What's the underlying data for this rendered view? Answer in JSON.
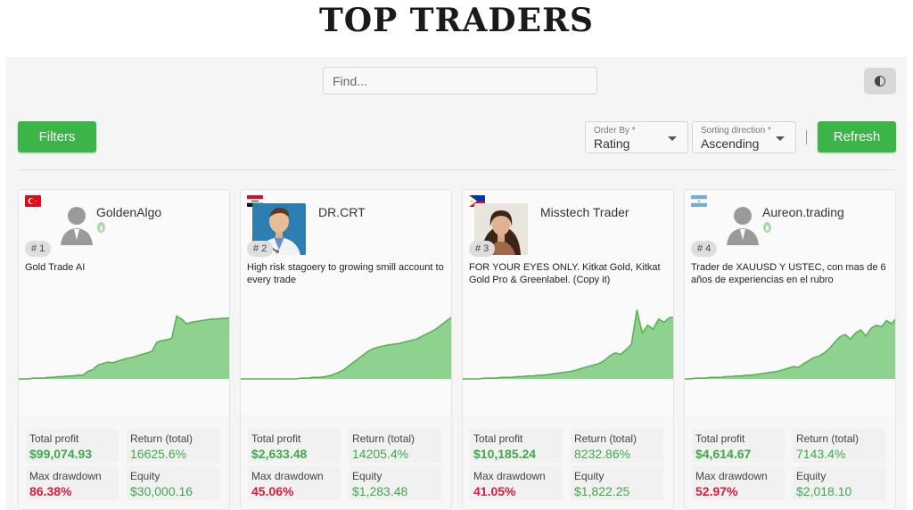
{
  "page_title": "TOP TRADERS",
  "search": {
    "placeholder": "Find..."
  },
  "toolbar": {
    "filters_label": "Filters",
    "refresh_label": "Refresh",
    "order_by": {
      "label": "Order By *",
      "value": "Rating"
    },
    "sorting_direction": {
      "label": "Sorting direction *",
      "value": "Ascending"
    }
  },
  "colors": {
    "accent": "#3cb448",
    "profit": "#3ea84a",
    "drawdown": "#d71c3f",
    "chart_fill": "#8fd18f",
    "chart_line": "#4fb24f"
  },
  "traders": [
    {
      "rank": "# 1",
      "name": "GoldenAlgo",
      "country_flag": "turkey",
      "avatar": "generic-user-icon",
      "description": "Gold Trade AI",
      "stats": {
        "total_profit_label": "Total profit",
        "total_profit": "$99,074.93",
        "return_label": "Return (total)",
        "return": "16625.6%",
        "max_drawdown_label": "Max drawdown",
        "max_drawdown": "86.38%",
        "equity_label": "Equity",
        "equity": "$30,000.16"
      },
      "equity_curve": [
        0.0,
        0.0,
        0.0,
        0.01,
        0.01,
        0.01,
        0.02,
        0.02,
        0.03,
        0.03,
        0.04,
        0.04,
        0.05,
        0.05,
        0.1,
        0.12,
        0.18,
        0.2,
        0.22,
        0.21,
        0.23,
        0.25,
        0.27,
        0.28,
        0.3,
        0.32,
        0.34,
        0.36,
        0.48,
        0.5,
        0.51,
        0.53,
        0.82,
        0.78,
        0.72,
        0.74,
        0.75,
        0.76,
        0.77,
        0.78,
        0.78,
        0.79,
        0.79,
        0.8
      ]
    },
    {
      "rank": "# 2",
      "name": "DR.CRT",
      "country_flag": "iraq",
      "avatar": "doctor-photo",
      "description": "High risk stagoery to growing smill account to every trade",
      "stats": {
        "total_profit_label": "Total profit",
        "total_profit": "$2,633.48",
        "return_label": "Return (total)",
        "return": "14205.4%",
        "max_drawdown_label": "Max drawdown",
        "max_drawdown": "45.06%",
        "equity_label": "Equity",
        "equity": "$1,283.48"
      },
      "equity_curve": [
        0.0,
        0.0,
        0.0,
        0.0,
        0.0,
        0.0,
        0.0,
        0.0,
        0.0,
        0.0,
        0.01,
        0.01,
        0.02,
        0.02,
        0.03,
        0.05,
        0.08,
        0.12,
        0.18,
        0.24,
        0.3,
        0.36,
        0.4,
        0.42,
        0.44,
        0.45,
        0.46,
        0.48,
        0.5,
        0.52,
        0.56,
        0.6,
        0.64,
        0.7,
        0.76,
        0.82
      ]
    },
    {
      "rank": "# 3",
      "name": "Misstech Trader",
      "country_flag": "philippines",
      "avatar": "woman-photo",
      "description": "FOR YOUR EYES ONLY. Kitkat Gold, Kitkat Gold Pro & Greenlabel. (Copy it)",
      "stats": {
        "total_profit_label": "Total profit",
        "total_profit": "$10,185.24",
        "return_label": "Return (total)",
        "return": "8232.86%",
        "max_drawdown_label": "Max drawdown",
        "max_drawdown": "41.05%",
        "equity_label": "Equity",
        "equity": "$1,822.25"
      },
      "equity_curve": [
        0.0,
        0.0,
        0.0,
        0.0,
        0.01,
        0.01,
        0.01,
        0.02,
        0.02,
        0.02,
        0.03,
        0.03,
        0.04,
        0.04,
        0.05,
        0.05,
        0.06,
        0.07,
        0.08,
        0.09,
        0.1,
        0.12,
        0.14,
        0.16,
        0.18,
        0.2,
        0.24,
        0.3,
        0.34,
        0.32,
        0.38,
        0.45,
        0.9,
        0.6,
        0.7,
        0.65,
        0.78,
        0.74,
        0.8,
        0.8
      ]
    },
    {
      "rank": "# 4",
      "name": "Aureon.trading",
      "country_flag": "argentina",
      "avatar": "generic-user-icon",
      "description": "Trader de XAUUSD Y USTEC, con mas de 6 años de experiencias en el rubro",
      "stats": {
        "total_profit_label": "Total profit",
        "total_profit": "$4,614.67",
        "return_label": "Return (total)",
        "return": "7143.4%",
        "max_drawdown_label": "Max drawdown",
        "max_drawdown": "52.97%",
        "equity_label": "Equity",
        "equity": "$2,018.10"
      },
      "equity_curve": [
        0.0,
        0.0,
        0.01,
        0.01,
        0.01,
        0.02,
        0.02,
        0.02,
        0.03,
        0.03,
        0.04,
        0.04,
        0.05,
        0.05,
        0.06,
        0.07,
        0.08,
        0.09,
        0.1,
        0.12,
        0.14,
        0.16,
        0.15,
        0.2,
        0.24,
        0.28,
        0.3,
        0.34,
        0.4,
        0.48,
        0.55,
        0.58,
        0.52,
        0.6,
        0.64,
        0.56,
        0.66,
        0.7,
        0.68,
        0.76,
        0.72,
        0.8
      ]
    }
  ]
}
